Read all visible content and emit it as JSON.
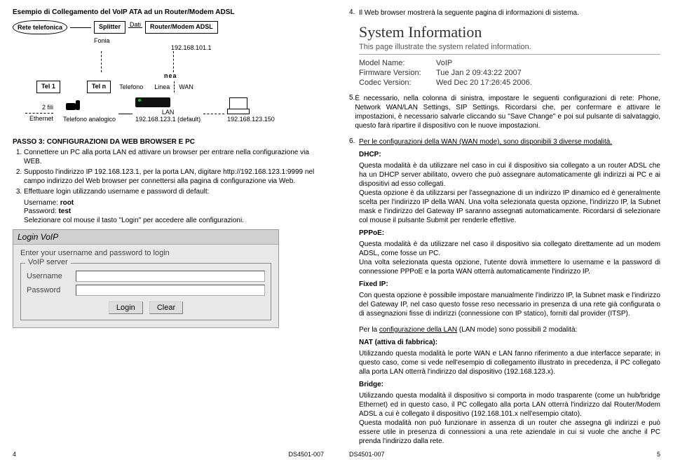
{
  "left": {
    "title": "Esempio di Collegamento del VoIP ATA ad un Router/Modem ADSL",
    "diagram": {
      "rete": "Rete telefonica",
      "splitter": "Splitter",
      "dati": "Dati",
      "fonia": "Fonia",
      "router": "Router/Modem ADSL",
      "router_ip": "192.168.101.1",
      "nea": "nea",
      "tel1": "Tel 1",
      "teln": "Tel n",
      "telefono": "Telefono",
      "linea": "Linea",
      "wan": "WAN",
      "fili": "2 fili",
      "ethernet": "Ethernet",
      "tel_analog": "Telefono analogico",
      "lan_ip_label": "LAN",
      "lan_ip": "192.168.123.1 (default)",
      "pc_ip": "192.168.123.150"
    },
    "step3_heading": "PASSO 3: CONFIGURAZIONI DA WEB BROWSER E PC",
    "steps": [
      "Connettere un PC alla porta LAN ed attivare un browser per entrare nella configurazione via WEB.",
      "Supposto l'indirizzo IP 192.168.123.1, per la porta LAN, digitare http://192.168.123.1:9999 nel campo indirizzo del Web browser per connettersi alla pagina di configurazione via Web.",
      "Effettuare login utilizzando username e password di default:"
    ],
    "creds": {
      "u_label": "Username:",
      "u_val": "root",
      "p_label": "Password:",
      "p_val": "test",
      "note": "Selezionare col mouse il tasto \"Login\" per accedere alle configurazioni."
    },
    "login": {
      "title": "Login VoIP",
      "prompt": "Enter your username and password to login",
      "legend": "VoIP server",
      "username": "Username",
      "password": "Password",
      "login_btn": "Login",
      "clear_btn": "Clear"
    },
    "page_num": "4",
    "doc_code": "DS4501-007"
  },
  "right": {
    "intro4": "Il Web browser mostrerà la seguente pagina di informazioni di sistema.",
    "sysinfo": {
      "title": "System Information",
      "subtitle": "This page illustrate the system related information.",
      "rows": [
        {
          "k": "Model Name:",
          "v": "VoIP"
        },
        {
          "k": "Firmware Version:",
          "v": "Tue Jan 2 09:43:22 2007"
        },
        {
          "k": "Codec Version:",
          "v": "Wed Dec 20 17:26:45 2006."
        }
      ]
    },
    "item5": "È necessario, nella colonna di sinistra, impostare le seguenti configurazioni di rete: Phone, Network WAN/LAN Settings, SIP Settings. Ricordarsi che, per confermare e attivare le impostazioni, è necessario salvarle cliccando su \"Save Change\" e poi sul pulsante di salvataggio, questo farà ripartire il dispositivo con le nuove impostazioni.",
    "item6_intro": "Per le configurazioni della WAN (WAN mode), sono disponibili 3 diverse modalità.",
    "dhcp_label": "DHCP:",
    "dhcp_text": "Questa modalità è da utilizzare nel caso in cui il dispositivo sia collegato a un router ADSL che ha un DHCP server abilitato, ovvero che può assegnare automaticamente gli indirizzi ai PC e ai dispositivi ad esso collegati.\nQuesta opzione è da utilizzarsi per l'assegnazione di un indirizzo IP dinamico ed è generalmente scelta per l'indirizzo IP della WAN. Una volta selezionata questa opzione, l'indirizzo IP, la Subnet mask e l'indirizzo del Gateway IP saranno assegnati automaticamente. Ricordarsi di selezionare col mouse il pulsante Submit per renderle effettive.",
    "pppoe_label": "PPPoE:",
    "pppoe_text": "Questa modalità è da utilizzare nel caso il dispositivo sia collegato direttamente ad un modem ADSL, come fosse un PC.\nUna volta selezionata questa opzione, l'utente dovrà immettere lo username e la password di connessione PPPoE e la porta WAN otterrà automaticamente l'indirizzo IP.",
    "fixed_label": "Fixed IP:",
    "fixed_text": "Con questa opzione è possibile impostare manualmente l'indirizzo IP, la Subnet mask e l'indirizzo del Gateway IP, nel caso questo fosse reso necessario in presenza di una rete già configurata o di assegnazioni fisse di indirizzi (connessione con IP statico), forniti dal provider (ITSP).",
    "lan_intro": "Per la configurazione della LAN (LAN mode) sono possibili 2 modalità:",
    "nat_label": "NAT (attiva di fabbrica):",
    "nat_text": "Utilizzando questa modalità le porte WAN e LAN fanno riferimento a due interfacce separate; in questo caso, come si vede nell'esempio di collegamento illustrato in precedenza, il PC collegato alla porta LAN otterrà l'indirizzo dal dispositivo (192.168.123.x).",
    "bridge_label": "Bridge:",
    "bridge_text": "Utilizzando questa modalità il dispositivo si comporta in modo trasparente (come un hub/bridge Ethernet) ed in questo caso, il PC collegato alla porta LAN otterrà l'indirizzo dal Router/Modem ADSL a cui è collegato il dispositivo (192.168.101.x nell'esempio citato).\nQuesta modalità non può funzionare in assenza di un router che assegna gli indirizzi e può essere utile in presenza di connessioni a una rete aziendale in cui si vuole che anche il PC prenda l'indirizzo dalla rete.",
    "page_num": "5",
    "doc_code": "DS4501-007"
  }
}
